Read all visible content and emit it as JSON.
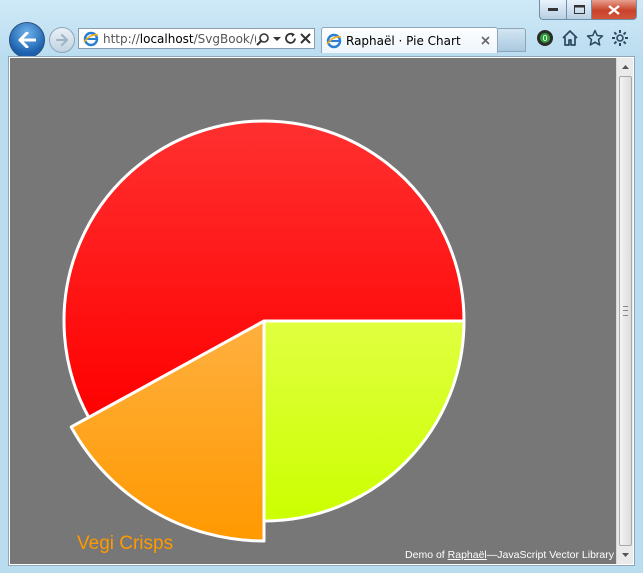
{
  "window": {
    "minimize_icon": "minimize-icon",
    "maximize_icon": "maximize-icon",
    "close_icon": "close-icon"
  },
  "navigation": {
    "back_icon": "back-arrow-icon",
    "forward_icon": "forward-arrow-icon",
    "address": {
      "prefix": "http://",
      "host": "localhost",
      "path": "/SvgBook/("
    }
  },
  "tab": {
    "title": "Raphaël · Pie Chart",
    "close_icon": "close-icon"
  },
  "toolbar": {
    "icons": [
      "addon-icon",
      "home-icon",
      "favorites-star-icon",
      "settings-gear-icon"
    ]
  },
  "page": {
    "background_color": "#777777",
    "hover_label": "Vegi Crisps",
    "credit": {
      "prefix": "Demo of ",
      "link_text": "Raphaël",
      "suffix": "—JavaScript Vector Library"
    }
  },
  "chart_data": {
    "type": "pie",
    "title": "",
    "slices": [
      {
        "label": "",
        "value": 58,
        "color": "#ff0000",
        "color_light": "#ff3030"
      },
      {
        "label": "",
        "value": 25,
        "color": "#ccff00",
        "color_light": "#e0ff40"
      },
      {
        "label": "Vegi Crisps",
        "value": 17,
        "color": "#ff9900",
        "color_light": "#ffb040",
        "exploded": true
      }
    ],
    "stroke_color": "#ffffff"
  }
}
